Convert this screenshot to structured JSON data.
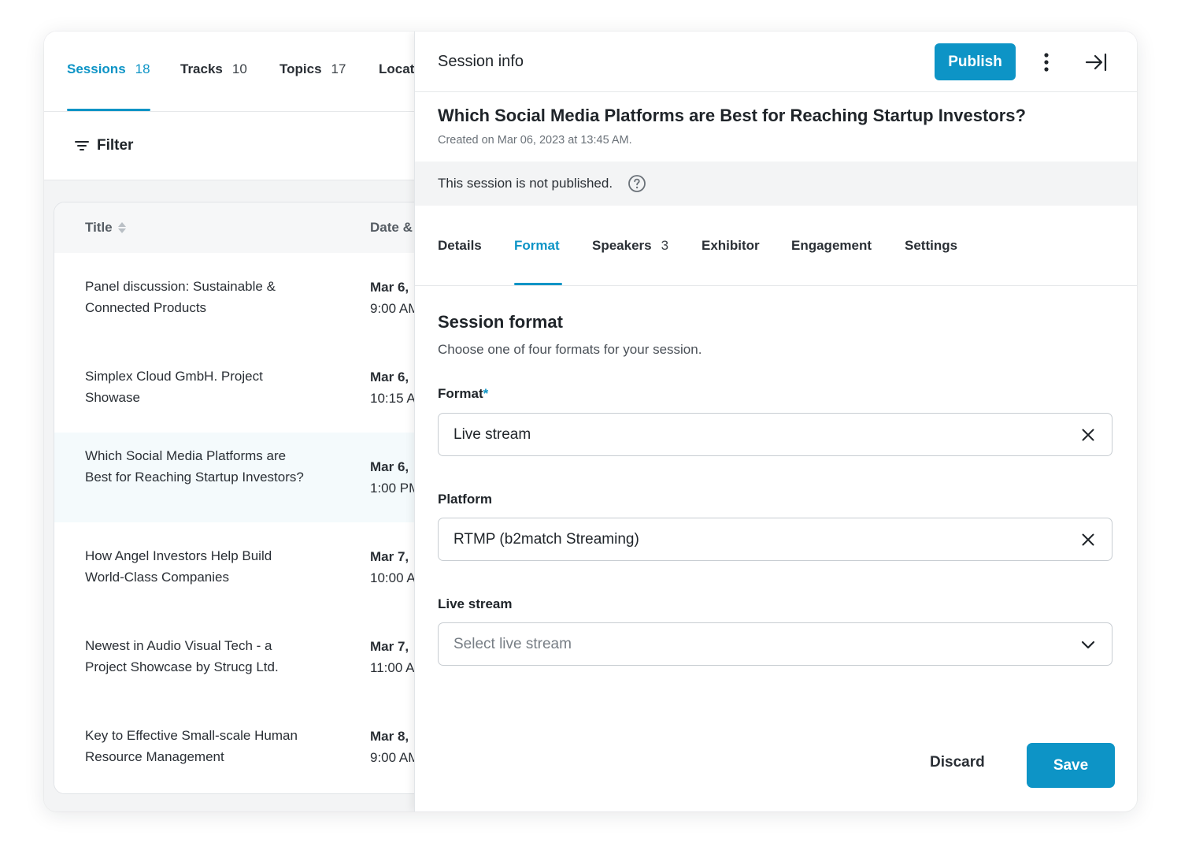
{
  "left": {
    "tabs": [
      {
        "label": "Sessions",
        "count": "18"
      },
      {
        "label": "Tracks",
        "count": "10"
      },
      {
        "label": "Topics",
        "count": "17"
      },
      {
        "label": "Locat",
        "count": ""
      }
    ],
    "filter_label": "Filter",
    "table": {
      "headers": [
        "Title",
        "Date &"
      ],
      "rows": [
        {
          "title": "Panel discussion: Sustainable & Connected Products",
          "date": "Mar 6,",
          "time": "9:00 AM"
        },
        {
          "title": "Simplex Cloud GmbH. Project Showase",
          "date": "Mar 6,",
          "time": "10:15 A"
        },
        {
          "title": "Which Social Media Platforms are Best for Reaching Startup Investors?",
          "date": "Mar 6,",
          "time": "1:00 PM"
        },
        {
          "title": "How Angel Investors Help Build World-Class Companies",
          "date": "Mar 7,",
          "time": "10:00 A"
        },
        {
          "title": "Newest in Audio Visual Tech - a Project Showcase by Strucg Ltd.",
          "date": "Mar 7,",
          "time": "11:00 A"
        },
        {
          "title": "Key to Effective Small-scale Human Resource Management",
          "date": "Mar 8,",
          "time": "9:00 AM"
        }
      ]
    }
  },
  "panel": {
    "header_title": "Session info",
    "publish_label": "Publish",
    "session_title": "Which Social Media Platforms are Best for Reaching Startup Investors?",
    "created": "Created on Mar 06, 2023 at 13:45 AM.",
    "status_text": "This session is not published.",
    "tabs": [
      {
        "label": "Details",
        "count": ""
      },
      {
        "label": "Format",
        "count": ""
      },
      {
        "label": "Speakers",
        "count": "3"
      },
      {
        "label": "Exhibitor",
        "count": ""
      },
      {
        "label": "Engagement",
        "count": ""
      },
      {
        "label": "Settings",
        "count": ""
      }
    ],
    "section_title": "Session format",
    "section_desc": "Choose one of four formats for your session.",
    "format_label": "Format",
    "required_mark": "*",
    "format_value": "Live stream",
    "platform_label": "Platform",
    "platform_value": "RTMP (b2match Streaming)",
    "livestream_label": "Live stream",
    "livestream_placeholder": "Select live stream",
    "discard_label": "Discard",
    "save_label": "Save"
  },
  "colors": {
    "accent": "#0d94c6",
    "selected_row": "#f4fafc",
    "panel_gray": "#f3f4f5"
  },
  "icons": [
    "filter-icon",
    "sort-icon",
    "more-vertical-icon",
    "collapse-panel-icon",
    "help-circle-icon",
    "clear-icon",
    "chevron-down-icon"
  ]
}
